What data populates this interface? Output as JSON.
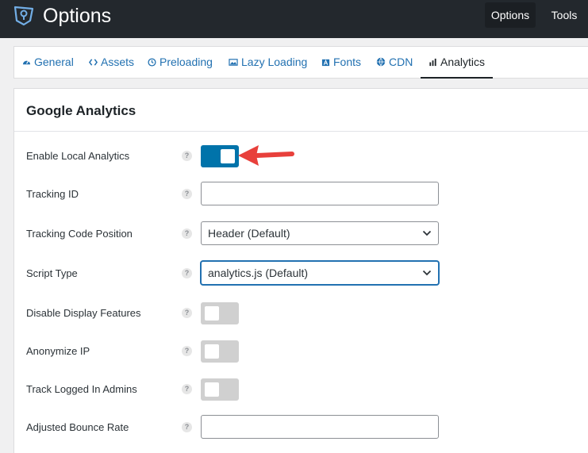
{
  "header": {
    "title": "Options",
    "buttons": [
      {
        "label": "Options",
        "active": true
      },
      {
        "label": "Tools",
        "active": false
      }
    ]
  },
  "tabs": [
    {
      "label": "General",
      "icon": "dashboard-icon",
      "active": false
    },
    {
      "label": "Assets",
      "icon": "code-icon",
      "active": false
    },
    {
      "label": "Preloading",
      "icon": "clock-icon",
      "active": false
    },
    {
      "label": "Lazy Loading",
      "icon": "image-icon",
      "active": false
    },
    {
      "label": "Fonts",
      "icon": "font-icon",
      "active": false
    },
    {
      "label": "CDN",
      "icon": "globe-icon",
      "active": false
    },
    {
      "label": "Analytics",
      "icon": "bar-chart-icon",
      "active": true
    }
  ],
  "section": {
    "title": "Google Analytics",
    "rows": [
      {
        "label": "Enable Local Analytics",
        "type": "toggle",
        "on": true
      },
      {
        "label": "Tracking ID",
        "type": "text",
        "value": ""
      },
      {
        "label": "Tracking Code Position",
        "type": "select",
        "value": "Header (Default)"
      },
      {
        "label": "Script Type",
        "type": "select",
        "value": "analytics.js (Default)",
        "focused": true
      },
      {
        "label": "Disable Display Features",
        "type": "toggle",
        "on": false
      },
      {
        "label": "Anonymize IP",
        "type": "toggle",
        "on": false
      },
      {
        "label": "Track Logged In Admins",
        "type": "toggle",
        "on": false
      },
      {
        "label": "Adjusted Bounce Rate",
        "type": "text",
        "value": ""
      }
    ]
  },
  "help_glyph": "?",
  "colors": {
    "topbar": "#23282d",
    "accent": "#0073aa",
    "link": "#2271b1",
    "annotation_arrow": "#e8403b"
  }
}
